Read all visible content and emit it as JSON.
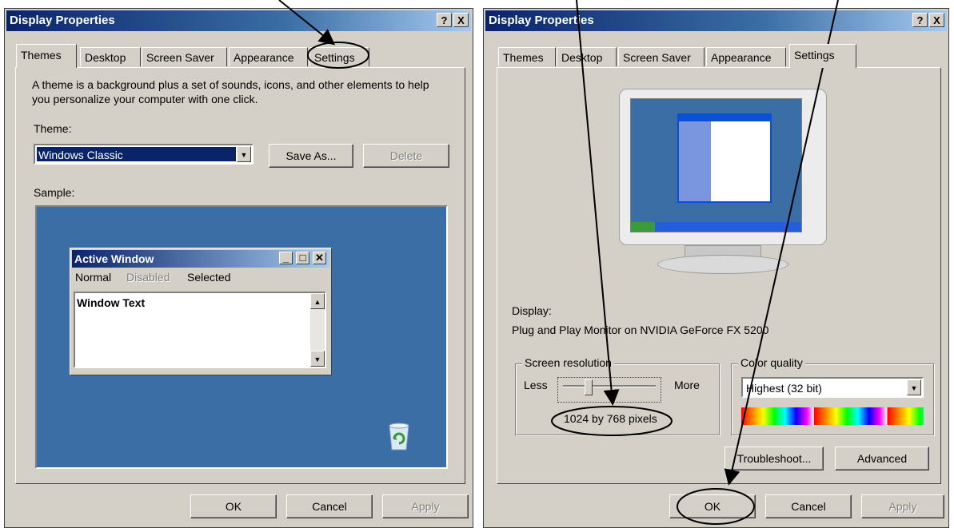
{
  "left_dialog": {
    "title": "Display Properties",
    "help_btn": "?",
    "close_btn": "X",
    "tabs": [
      "Themes",
      "Desktop",
      "Screen Saver",
      "Appearance",
      "Settings"
    ],
    "active_tab": "Themes",
    "description": "A theme is a background plus a set of sounds, icons, and other elements to help you personalize your computer with one click.",
    "theme_label": "Theme:",
    "theme_value": "Windows Classic",
    "save_as": "Save As...",
    "delete": "Delete",
    "sample_label": "Sample:",
    "sample": {
      "window_title": "Active Window",
      "menu": [
        "Normal",
        "Disabled",
        "Selected"
      ],
      "window_text": "Window Text",
      "desktop_color": "#3a6ea5"
    },
    "ok": "OK",
    "cancel": "Cancel",
    "apply": "Apply"
  },
  "right_dialog": {
    "title": "Display Properties",
    "help_btn": "?",
    "close_btn": "X",
    "tabs": [
      "Themes",
      "Desktop",
      "Screen Saver",
      "Appearance",
      "Settings"
    ],
    "active_tab": "Settings",
    "display_label": "Display:",
    "display_value": "Plug and Play Monitor on NVIDIA GeForce FX 5200",
    "screen_resolution_label": "Screen resolution",
    "less": "Less",
    "more": "More",
    "resolution_value": "1024 by 768 pixels",
    "slider_position": 0.25,
    "color_quality_label": "Color quality",
    "color_quality_value": "Highest (32 bit)",
    "troubleshoot": "Troubleshoot...",
    "advanced": "Advanced",
    "ok": "OK",
    "cancel": "Cancel",
    "apply": "Apply"
  }
}
